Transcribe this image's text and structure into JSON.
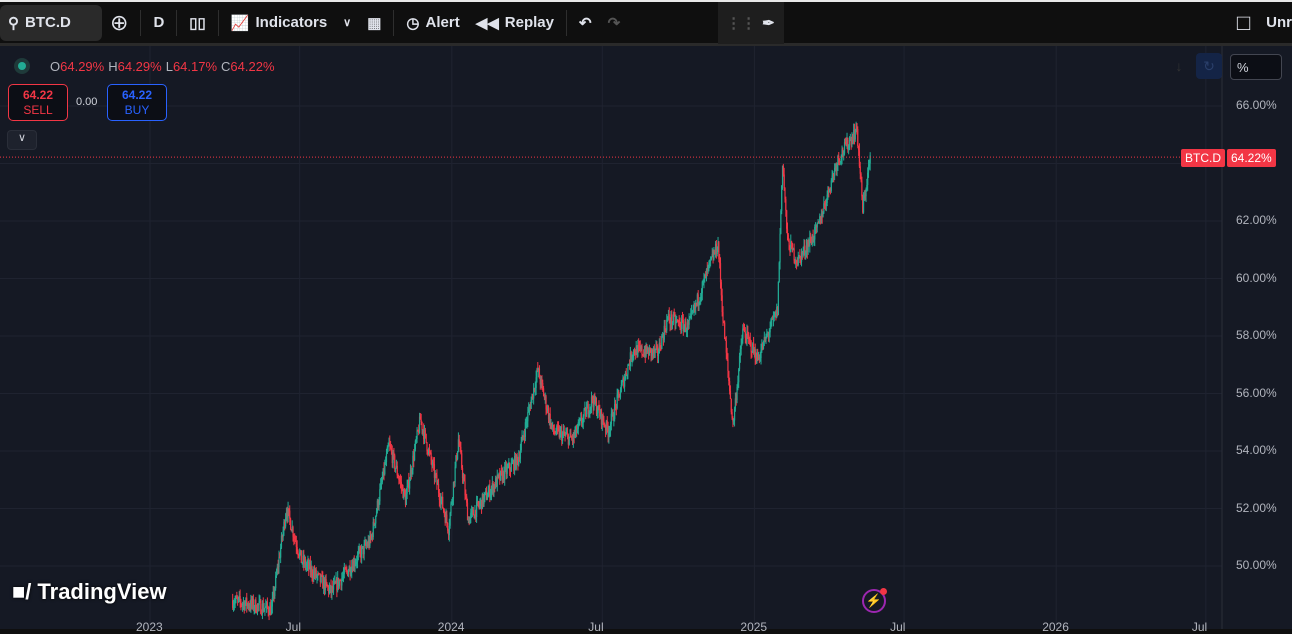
{
  "toolbar": {
    "symbol": "BTC.D",
    "interval": "D",
    "indicators": "Indicators",
    "alert": "Alert",
    "replay": "Replay",
    "right_label": "Unr"
  },
  "legend": {
    "o_label": "O",
    "o": "64.29%",
    "h_label": "H",
    "h": "64.29%",
    "l_label": "L",
    "l": "64.17%",
    "c_label": "C",
    "c": "64.22%"
  },
  "trade": {
    "sell_price": "64.22",
    "sell_label": "SELL",
    "spread": "0.00",
    "buy_price": "64.22",
    "buy_label": "BUY"
  },
  "price_scale": {
    "unit": "%",
    "last_symbol": "BTC.D",
    "last_price": "64.22%"
  },
  "brand": "TradingView",
  "colors": {
    "up": "#22ab94",
    "down": "#f23645",
    "background": "#151924"
  },
  "chart_data": {
    "type": "candlestick",
    "symbol": "BTC.D",
    "interval": "D",
    "y_ticks": [
      "66.00%",
      "62.00%",
      "60.00%",
      "58.00%",
      "56.00%",
      "54.00%",
      "52.00%",
      "50.00%"
    ],
    "x_ticks": [
      "2023",
      "Jul",
      "2024",
      "Jul",
      "2025",
      "Jul",
      "2026",
      "Jul"
    ],
    "ylim": [
      48.5,
      66.5
    ],
    "grid": true,
    "last_price": 64.22,
    "approx_path": [
      [
        "2023-04-10",
        48.8
      ],
      [
        "2023-05-28",
        48.5
      ],
      [
        "2023-06-15",
        52.0
      ],
      [
        "2023-07-03",
        50.2
      ],
      [
        "2023-08-08",
        49.1
      ],
      [
        "2023-09-25",
        50.9
      ],
      [
        "2023-10-17",
        54.2
      ],
      [
        "2023-11-06",
        52.3
      ],
      [
        "2023-11-24",
        55.1
      ],
      [
        "2023-12-28",
        51.3
      ],
      [
        "2024-01-09",
        54.4
      ],
      [
        "2024-01-21",
        51.6
      ],
      [
        "2024-02-26",
        53.0
      ],
      [
        "2024-03-21",
        53.7
      ],
      [
        "2024-04-14",
        56.8
      ],
      [
        "2024-05-02",
        54.7
      ],
      [
        "2024-05-26",
        54.4
      ],
      [
        "2024-06-19",
        55.8
      ],
      [
        "2024-07-08",
        54.7
      ],
      [
        "2024-08-07",
        57.5
      ],
      [
        "2024-09-06",
        57.4
      ],
      [
        "2024-09-18",
        58.6
      ],
      [
        "2024-10-13",
        58.3
      ],
      [
        "2024-11-06",
        60.3
      ],
      [
        "2024-11-18",
        61.2
      ],
      [
        "2024-11-24",
        58.6
      ],
      [
        "2024-12-06",
        54.9
      ],
      [
        "2024-12-18",
        58.2
      ],
      [
        "2025-01-05",
        57.2
      ],
      [
        "2025-01-29",
        58.9
      ],
      [
        "2025-02-04",
        64.1
      ],
      [
        "2025-02-10",
        61.3
      ],
      [
        "2025-02-22",
        60.6
      ],
      [
        "2025-03-18",
        61.7
      ],
      [
        "2025-04-11",
        64.1
      ],
      [
        "2025-05-05",
        65.2
      ],
      [
        "2025-05-12",
        62.4
      ],
      [
        "2025-05-21",
        64.2
      ]
    ]
  }
}
